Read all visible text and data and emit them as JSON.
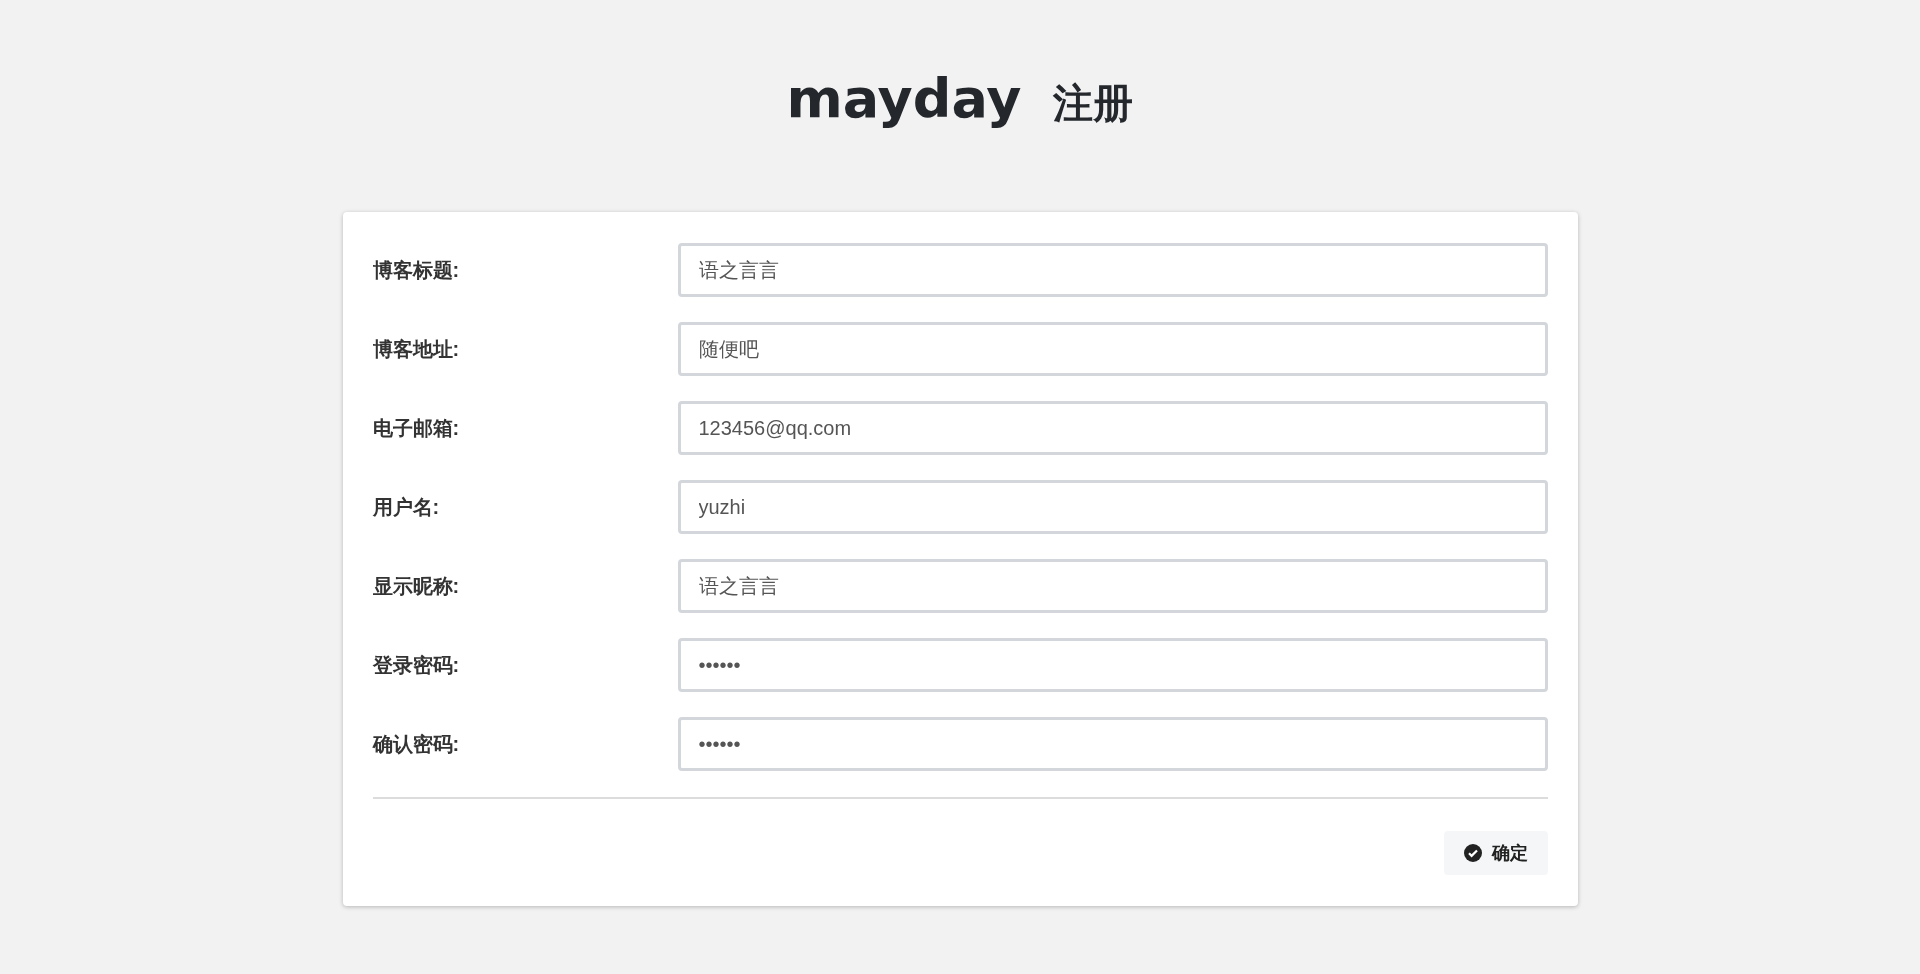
{
  "heading": {
    "brand": "mayday",
    "subtitle": "注册"
  },
  "fields": [
    {
      "label": "博客标题:",
      "value": "语之言言"
    },
    {
      "label": "博客地址:",
      "value": "随便吧"
    },
    {
      "label": "电子邮箱:",
      "value": "123456@qq.com"
    },
    {
      "label": "用户名:",
      "value": "yuzhi"
    },
    {
      "label": "显示昵称:",
      "value": "语之言言"
    },
    {
      "label": "登录密码:",
      "value": "••••••"
    },
    {
      "label": "确认密码:",
      "value": "••••••"
    }
  ],
  "submit": {
    "label": "确定"
  }
}
